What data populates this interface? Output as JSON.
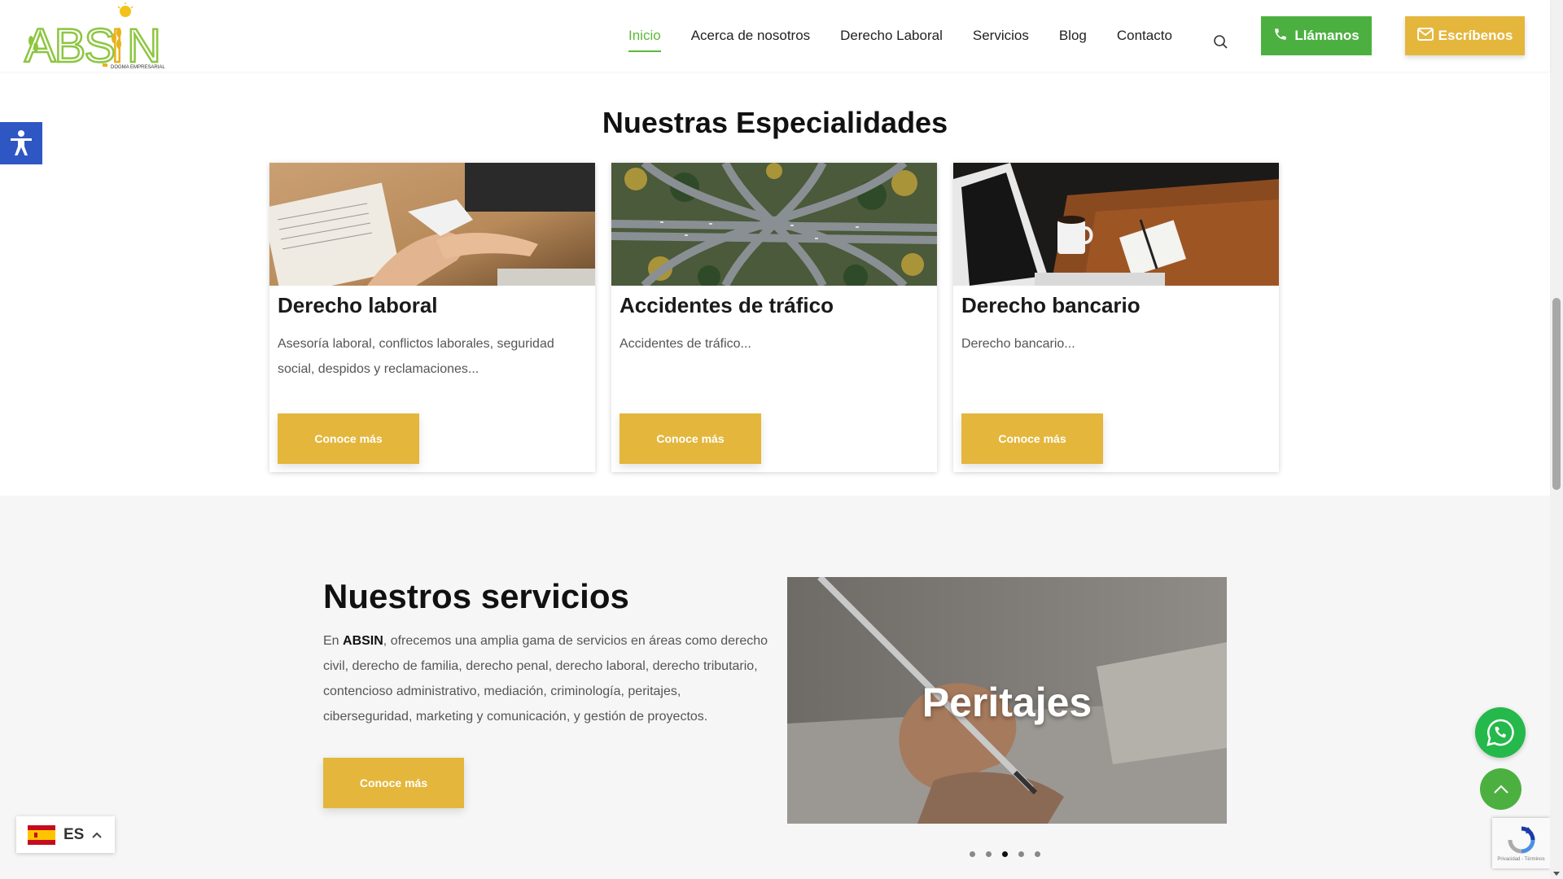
{
  "header": {
    "logo_text": "ABSIN",
    "logo_tagline": "DOGMA EMPRESARIAL",
    "nav": [
      {
        "label": "Inicio",
        "active": true
      },
      {
        "label": "Acerca de nosotros",
        "active": false
      },
      {
        "label": "Derecho Laboral",
        "active": false
      },
      {
        "label": "Servicios",
        "active": false
      },
      {
        "label": "Blog",
        "active": false
      },
      {
        "label": "Contacto",
        "active": false
      }
    ],
    "call_label": "Llámanos",
    "write_label": "Escríbenos"
  },
  "specialties": {
    "title": "Nuestras Especialidades",
    "cards": [
      {
        "title": "Derecho laboral",
        "desc": "Asesoría laboral, conflictos laborales, seguridad social, despidos y reclamaciones...",
        "button": "Conoce más",
        "image": "handshake-photo"
      },
      {
        "title": "Accidentes de tráfico",
        "desc": "Accidentes de tráfico...",
        "button": "Conoce más",
        "image": "highway-interchange-photo"
      },
      {
        "title": "Derecho bancario",
        "desc": "Derecho bancario...",
        "button": "Conoce más",
        "image": "desk-coffee-photo"
      }
    ]
  },
  "services": {
    "title": "Nuestros servicios",
    "text_prefix": "En ",
    "text_brand": "ABSIN",
    "text_body": ", ofrecemos una amplia gama de servicios en áreas como derecho civil, derecho de familia, derecho penal, derecho laboral, derecho tributario, contencioso administrativo, mediación, criminología, peritajes, ciberseguridad, marketing y comunicación, y gestión de proyectos.",
    "button": "Conoce más",
    "slider": {
      "caption": "Peritajes",
      "slide_count": 5,
      "active_index": 2
    }
  },
  "language": {
    "code": "ES",
    "flag": "spain-flag-icon"
  },
  "recaptcha": {
    "terms": "Privacidad - Términos"
  },
  "colors": {
    "green": "#4cb041",
    "gold": "#e4b63c",
    "accessibility_blue": "#2f57c4",
    "whatsapp": "#25b84a"
  }
}
